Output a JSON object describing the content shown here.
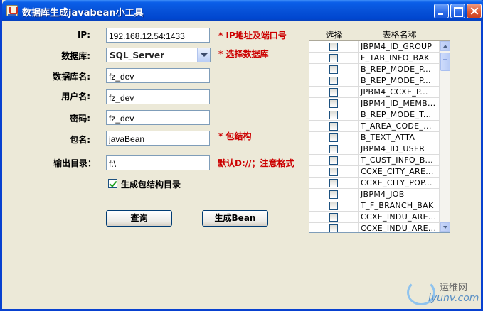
{
  "window": {
    "title": "数据库生成javabean小工具"
  },
  "form": {
    "ip": {
      "label": "IP:",
      "value": "192.168.12.54:1433",
      "hint": "* IP地址及端口号"
    },
    "db_type": {
      "label": "数据库:",
      "value": "SQL_Server",
      "hint": "* 选择数据库"
    },
    "db_name": {
      "label": "数据库名:",
      "value": "fz_dev"
    },
    "username": {
      "label": "用户名:",
      "value": "fz_dev"
    },
    "password": {
      "label": "密码:",
      "value": "fz_dev"
    },
    "package": {
      "label": "包名:",
      "value": "javaBean",
      "hint": "* 包结构"
    },
    "output_dir": {
      "label": "输出目录：",
      "value": "f:\\",
      "hint": "默认D://；注意格式"
    },
    "gen_package_dirs": {
      "label": "生成包结构目录",
      "checked": true
    }
  },
  "buttons": {
    "query": "查询",
    "generate": "生成Bean"
  },
  "table": {
    "headers": [
      "选择",
      "表格名称"
    ],
    "rows": [
      "JBPM4_ID_GROUP",
      "F_TAB_INFO_BAK",
      "B_REP_MODE_P...",
      "B_REP_MODE_P...",
      "JPBM4_CCXE_P...",
      "JBPM4_ID_MEMB...",
      "B_REP_MODE_T...",
      "T_AREA_CODE_...",
      "B_TEXT_ATTA",
      "JBPM4_ID_USER",
      "T_CUST_INFO_B...",
      "CCXE_CITY_ARE...",
      "CCXE_CITY_POP...",
      "JBPM4_JOB",
      "T_F_BRANCH_BAK",
      "CCXE_INDU_ARE...",
      "CCXE_INDU_ARE..."
    ]
  },
  "watermark": {
    "cn": "运维网",
    "en": "iyunv.com"
  },
  "colors": {
    "hint_red": "#cc0000",
    "titlebar_blue": "#0752d8"
  }
}
